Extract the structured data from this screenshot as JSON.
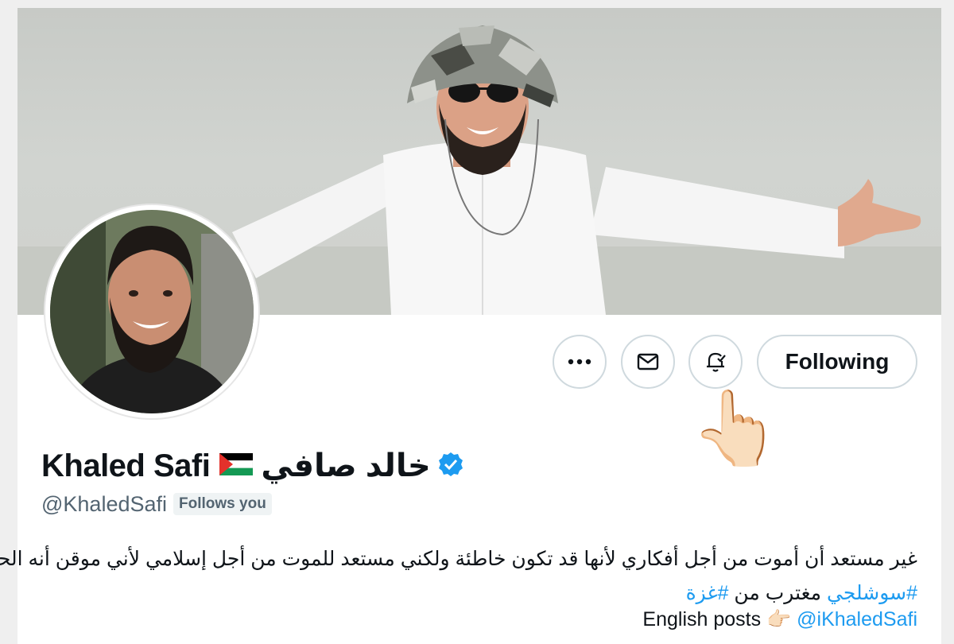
{
  "profile": {
    "name": "Khaled Safi",
    "arabic_name": "خالد صافي",
    "handle": "@KhaledSafi",
    "follows_badge": "Follows you",
    "verified": true,
    "flag_icon": "palestine-flag-icon"
  },
  "actions": {
    "more_icon": "more-icon",
    "message_icon": "mail-icon",
    "notify_icon": "bell-check-icon",
    "follow_label": "Following"
  },
  "pointer_emoji": "👆🏻",
  "bio": {
    "line1": "غير مستعد أن أموت من أجل أفكاري لأنها قد تكون خاطئة ولكني مستعد للموت من أجل إسلامي لأني موقن أنه الحق :",
    "line2_hashtag1": "#سوشلجي",
    "line2_text": " مغترب من ",
    "line2_hashtag2": "#غزة",
    "line3_text": "English posts ",
    "line3_emoji": "👉🏻",
    "line3_link": "@iKhaledSafi"
  },
  "colors": {
    "link": "#1d9bf0",
    "verified": "#1d9bf0",
    "border": "#cfd9de",
    "secondary_text": "#536471"
  }
}
